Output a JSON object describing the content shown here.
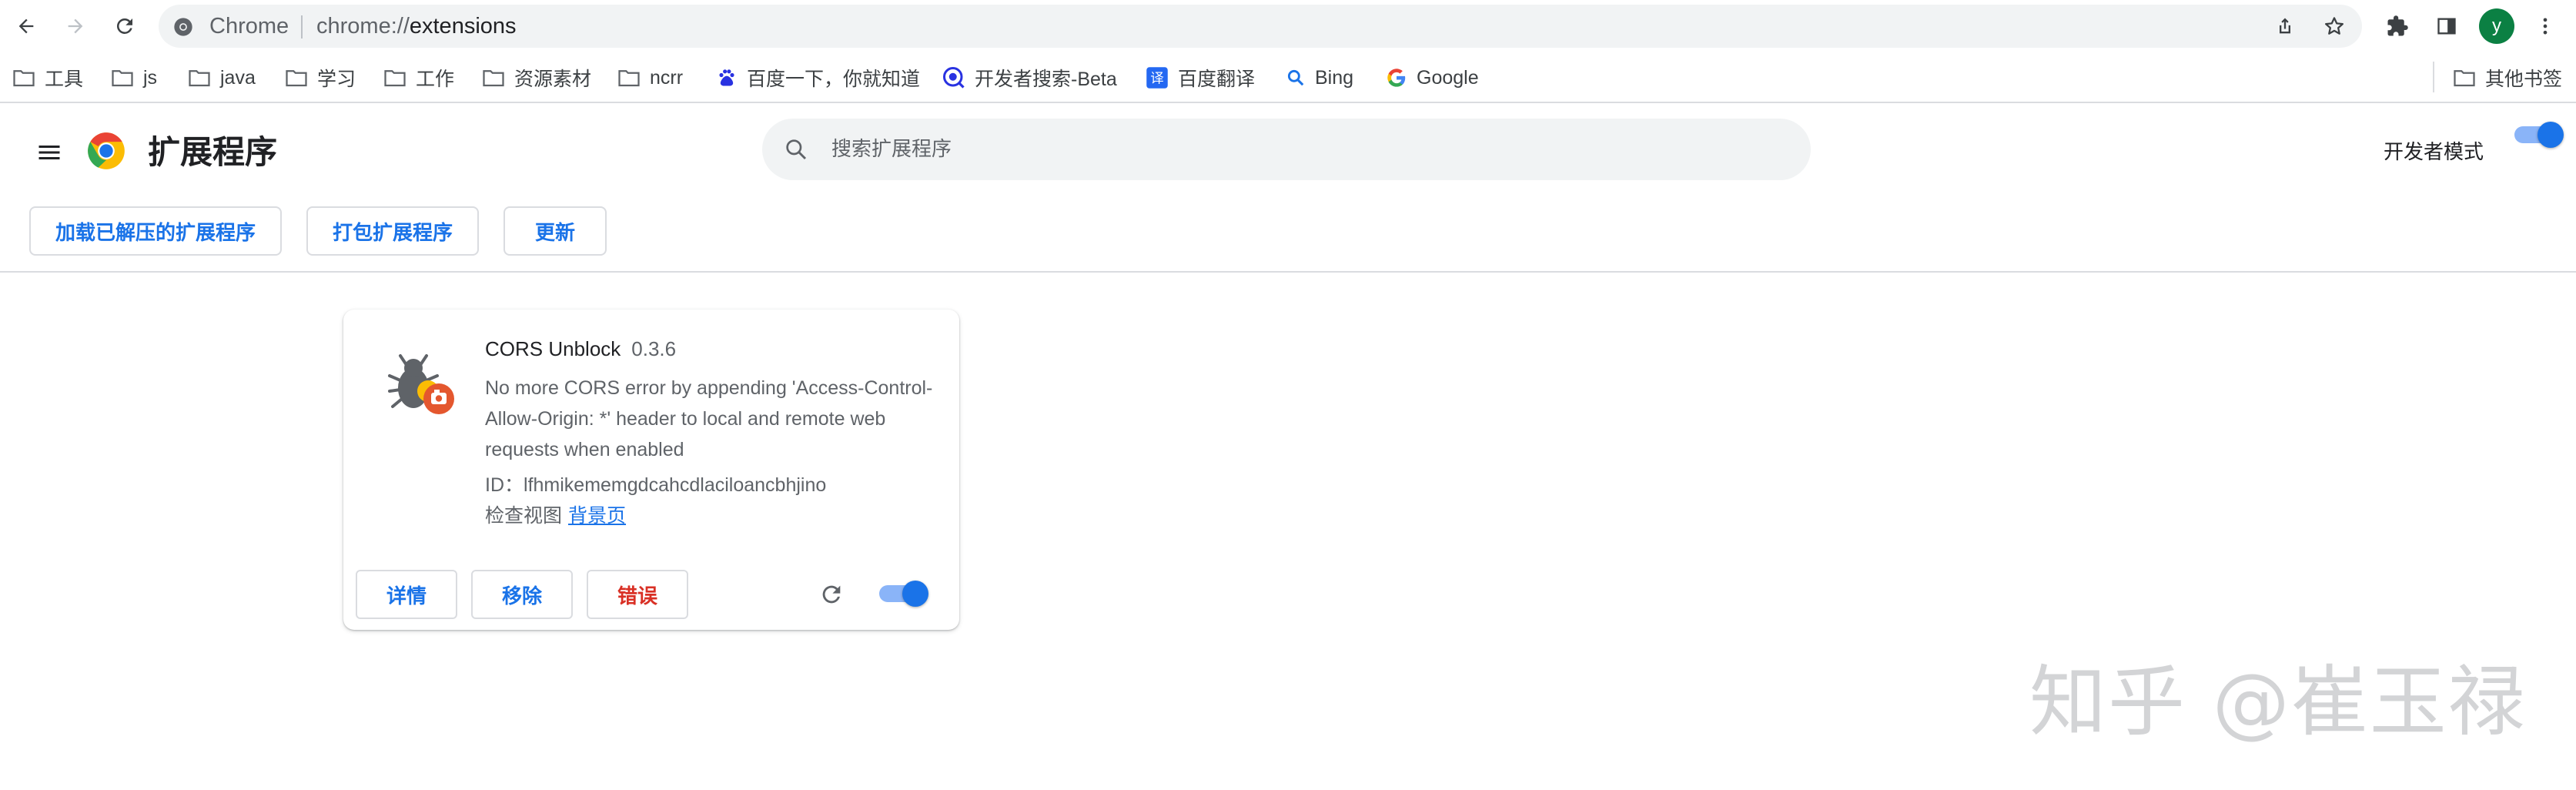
{
  "toolbar": {
    "site_name": "Chrome",
    "url_scheme": "chrome://",
    "url_host": "extensions",
    "avatar_letter": "y",
    "icons": [
      "back-icon",
      "forward-icon",
      "reload-icon",
      "share-icon",
      "star-icon",
      "puzzle-icon",
      "side-panel-icon",
      "more-vert-icon"
    ]
  },
  "bookmarks": {
    "items": [
      {
        "label": "工具",
        "icon": "folder-icon"
      },
      {
        "label": "js",
        "icon": "folder-icon"
      },
      {
        "label": "java",
        "icon": "folder-icon"
      },
      {
        "label": "学习",
        "icon": "folder-icon"
      },
      {
        "label": "工作",
        "icon": "folder-icon"
      },
      {
        "label": "资源素材",
        "icon": "folder-icon"
      },
      {
        "label": "ncrr",
        "icon": "folder-icon"
      },
      {
        "label": "百度一下，你就知道",
        "icon": "baidu-icon"
      },
      {
        "label": "开发者搜索-Beta",
        "icon": "dev-search-icon"
      },
      {
        "label": "百度翻译",
        "icon": "translate-icon"
      },
      {
        "label": "Bing",
        "icon": "bing-search-icon"
      },
      {
        "label": "Google",
        "icon": "google-icon"
      }
    ],
    "other": "其他书签"
  },
  "header": {
    "title": "扩展程序",
    "search_placeholder": "搜索扩展程序",
    "dev_mode_label": "开发者模式",
    "dev_mode_on": true
  },
  "actions": {
    "load_unpacked": "加载已解压的扩展程序",
    "pack": "打包扩展程序",
    "update": "更新"
  },
  "extension": {
    "name": "CORS Unblock",
    "version": "0.3.6",
    "description": "No more CORS error by appending 'Access-Control-Allow-Origin: *' header to local and remote web requests when enabled",
    "id_label": "ID：",
    "id": "lfhmikememgdcahcdlaciloancbhjino",
    "views_label": "检查视图",
    "views_link": "背景页",
    "details": "详情",
    "remove": "移除",
    "errors": "错误",
    "enabled": true
  },
  "watermark": "知乎 @崔玉禄",
  "colors": {
    "accent": "#1a73e8",
    "error": "#d93025",
    "avatar": "#0b8043"
  }
}
